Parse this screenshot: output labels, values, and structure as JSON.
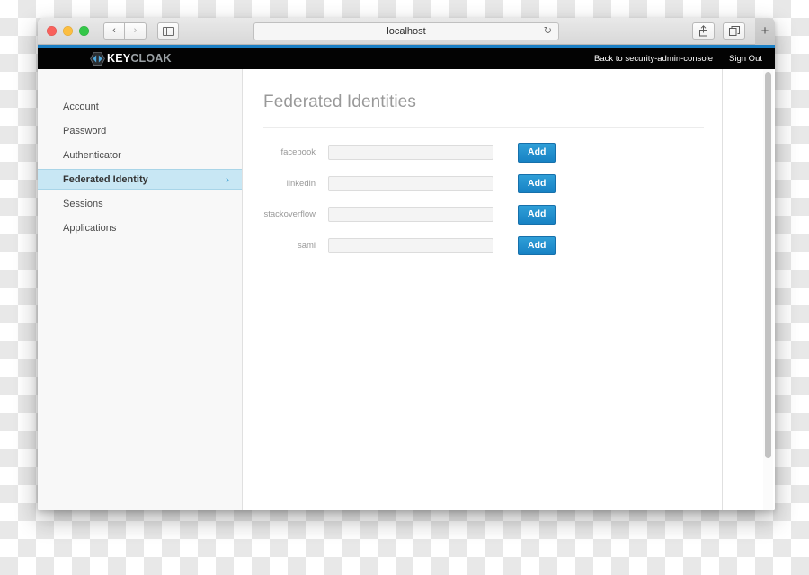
{
  "browser": {
    "traffic_lights": [
      "close",
      "minimize",
      "zoom"
    ],
    "back_label": "‹",
    "forward_label": "›",
    "sidebar_toggle_name": "sidebar-toggle-icon",
    "url": "localhost",
    "reload_glyph": "↻",
    "share_glyph": "↑",
    "tabs_glyph": "⧉",
    "newtab_label": "+"
  },
  "header": {
    "logo_text_primary": "KEY",
    "logo_text_secondary": "CLOAK",
    "links": [
      {
        "label": "Back to security-admin-console",
        "name": "back-to-admin-console-link"
      },
      {
        "label": "Sign Out",
        "name": "sign-out-link"
      }
    ]
  },
  "sidebar": {
    "items": [
      {
        "label": "Account",
        "active": false
      },
      {
        "label": "Password",
        "active": false
      },
      {
        "label": "Authenticator",
        "active": false
      },
      {
        "label": "Federated Identity",
        "active": true
      },
      {
        "label": "Sessions",
        "active": false
      },
      {
        "label": "Applications",
        "active": false
      }
    ],
    "active_chevron": "›"
  },
  "main": {
    "title": "Federated Identities",
    "add_button_label": "Add",
    "rows": [
      {
        "label": "facebook",
        "value": "",
        "placeholder": ""
      },
      {
        "label": "linkedin",
        "value": "",
        "placeholder": ""
      },
      {
        "label": "stackoverflow",
        "value": "",
        "placeholder": ""
      },
      {
        "label": "saml",
        "value": "",
        "placeholder": ""
      }
    ]
  },
  "colors": {
    "accent_blue": "#1b7fc4",
    "button_blue": "#1782c4",
    "active_nav_bg": "#c8e7f4",
    "header_black": "#030303",
    "sidebar_bg": "#f8f8f8",
    "title_grey": "#999999"
  }
}
